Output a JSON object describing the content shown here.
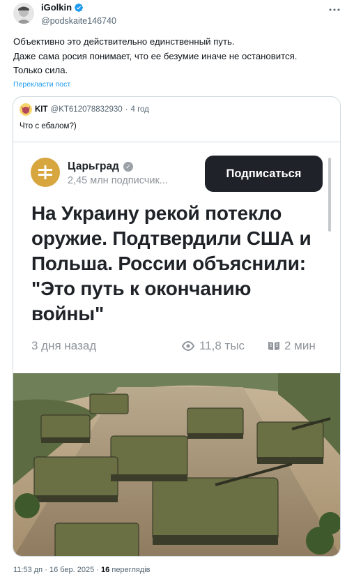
{
  "author": {
    "display_name": "iGolkin",
    "handle": "@podskaite146740",
    "verified": true
  },
  "tweet": {
    "lines": [
      "Объективно это действительно единственный путь.",
      "Даже сама росия понимает, что ее безумие иначе не остановится.",
      "Только сила."
    ],
    "translate_link": "Перекласти пост"
  },
  "quote": {
    "name": "KIT",
    "handle": "@KT612078832930",
    "separator": "·",
    "time": "4 год",
    "text": "Что с ебалом?)"
  },
  "article": {
    "channel_name": "Царьград",
    "channel_subscribers": "2,45 млн подписчик...",
    "subscribe_label": "Подписаться",
    "headline": "На Украину рекой потекло оружие. Подтвердили США и Польша. России объяснили: \"Это путь к окончанию войны\"",
    "date": "3 дня назад",
    "views": "11,8 тыс",
    "read_time": "2 мин",
    "image_alt_icon": "military-vehicles-illustration"
  },
  "footer": {
    "time": "11:53 дп",
    "separator": "·",
    "date": "16 бер. 2025",
    "views_count": "16",
    "views_label": "переглядів"
  },
  "colors": {
    "link": "#1d9bf0",
    "verified": "#1d9bf0",
    "subscribe_bg": "#1f2329",
    "channel_logo": "#d8a63f"
  }
}
